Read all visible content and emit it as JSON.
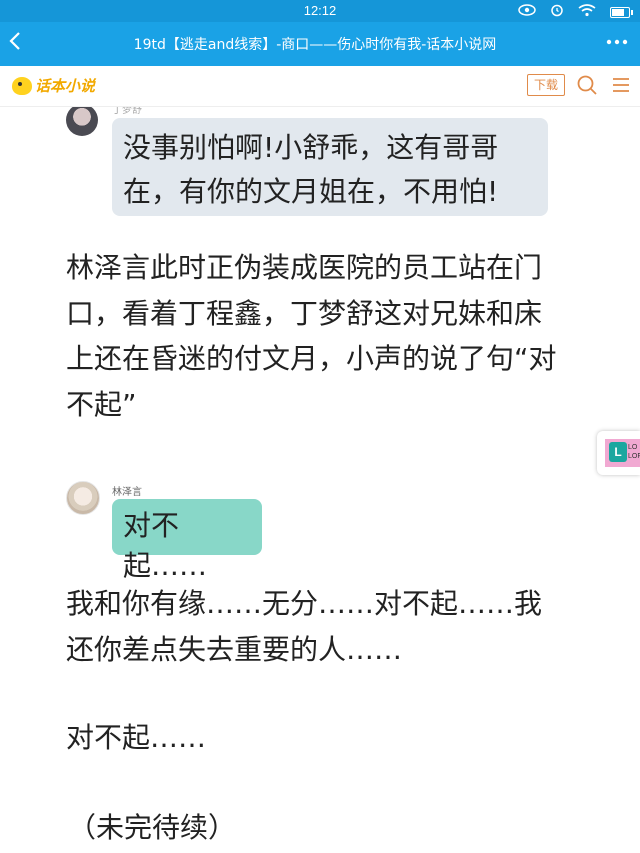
{
  "status_bar": {
    "time": "12:12"
  },
  "header": {
    "back_icon": "chevron-left-icon",
    "title": "19td【逃走and线索】-商口——伤心时你有我-话本小说网",
    "more_icon": "more-dots-icon"
  },
  "site_bar": {
    "logo_text": "话本小说",
    "download_label": "下载",
    "search_icon": "search-icon",
    "menu_icon": "menu-icon"
  },
  "story": {
    "dialogue_1": {
      "speaker": "丁梦舒",
      "text": "没事别怕啊!小舒乖，这有哥哥在，有你的文月姐在，不用怕!"
    },
    "narration_1": "林泽言此时正伪装成医院的员工站在门口，看着丁程鑫，丁梦舒这对兄妹和床上还在昏迷的付文月，小声的说了句“对不起”",
    "dialogue_2": {
      "speaker": "林泽言",
      "text": "对不起……"
    },
    "narration_2": "我和你有缘……无分……对不起……我还你差点失去重要的人……",
    "narration_3": "对不起……",
    "narration_4": "（未完待续）"
  },
  "ad": {
    "logo_letter": "L",
    "label_line_1": "LO",
    "label_line_2": "LOF"
  },
  "colors": {
    "status_bar": "#1596d8",
    "title_bar": "#1aa2e6",
    "bubble_1": "#e2e8ee",
    "bubble_2": "#88d7c8",
    "download_accent": "#e08b4a"
  }
}
